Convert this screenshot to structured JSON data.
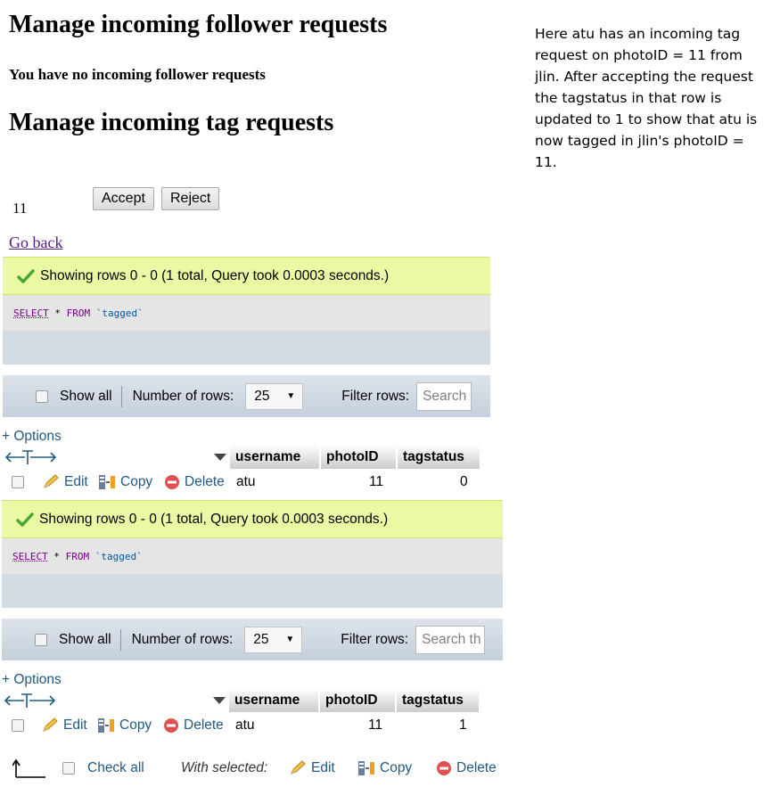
{
  "page": {
    "follower_heading": "Manage incoming follower requests",
    "no_follower_msg": "You have no incoming follower requests",
    "tag_heading": "Manage incoming tag requests",
    "tag_request_id": "11",
    "accept_label": "Accept",
    "reject_label": "Reject",
    "go_back": "Go back"
  },
  "note": "Here atu has an incoming tag request on photoID = 11 from jlin. After accepting the request the tagstatus in that row is updated to 1 to show that atu is now tagged in jlin's photoID = 11.",
  "panels": [
    {
      "success_msg": "Showing rows 0 - 0 (1 total, Query took 0.0003 seconds.)",
      "sql": {
        "select": "SELECT",
        "star": "*",
        "from": "FROM",
        "table": "`tagged`"
      },
      "show_all": "Show all",
      "num_rows_label": "Number of rows:",
      "num_rows_value": "25",
      "filter_label": "Filter rows:",
      "search_placeholder": "Search",
      "options": "+ Options",
      "columns": [
        "username",
        "photoID",
        "tagstatus"
      ],
      "row": {
        "edit": "Edit",
        "copy": "Copy",
        "delete": "Delete",
        "username": "atu",
        "photoID": "11",
        "tagstatus": "0"
      }
    },
    {
      "success_msg": "Showing rows 0 - 0 (1 total, Query took 0.0003 seconds.)",
      "sql": {
        "select": "SELECT",
        "star": "*",
        "from": "FROM",
        "table": "`tagged`"
      },
      "show_all": "Show all",
      "num_rows_label": "Number of rows:",
      "num_rows_value": "25",
      "filter_label": "Filter rows:",
      "search_placeholder": "Search th",
      "options": "+ Options",
      "columns": [
        "username",
        "photoID",
        "tagstatus"
      ],
      "row": {
        "edit": "Edit",
        "copy": "Copy",
        "delete": "Delete",
        "username": "atu",
        "photoID": "11",
        "tagstatus": "1"
      }
    }
  ],
  "footer": {
    "check_all": "Check all",
    "with_selected": "With selected:",
    "edit": "Edit",
    "copy": "Copy",
    "delete": "Delete"
  },
  "colors": {
    "link": "#235a81",
    "success_bg": "#ebf8a4",
    "visited_link": "#551a8b"
  }
}
